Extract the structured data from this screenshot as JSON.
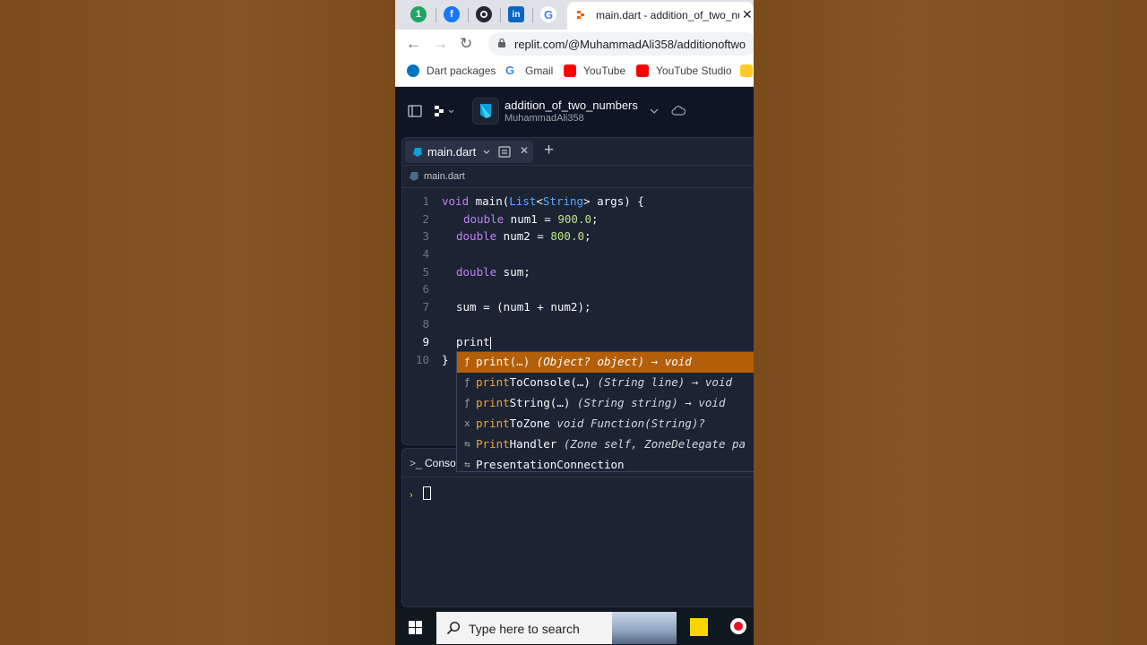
{
  "browser": {
    "tab_title": "main.dart - addition_of_two_num",
    "url": "replit.com/@MuhammadAli358/additionoftwo",
    "bookmarks": [
      "Dart packages",
      "Gmail",
      "YouTube",
      "YouTube Studio"
    ]
  },
  "replit": {
    "project_name": "addition_of_two_numbers",
    "project_user": "MuhammadAli358",
    "file_tab": "main.dart",
    "breadcrumb": "main.dart",
    "line_numbers": [
      "1",
      "2",
      "3",
      "4",
      "5",
      "6",
      "7",
      "8",
      "9",
      "10"
    ],
    "code": {
      "l1": {
        "kw": "void",
        "a": " main(",
        "ty1": "List",
        "b": "<",
        "ty2": "String",
        "c": "> args) {"
      },
      "l2": {
        "kw": "double",
        "a": " num1 = ",
        "num": "900.0",
        "b": ";"
      },
      "l3": {
        "kw": "double",
        "a": " num2 = ",
        "num": "800.0",
        "b": ";"
      },
      "l5": {
        "kw": "double",
        "a": " sum;"
      },
      "l7": "sum = (num1 + num2);",
      "l9": "print",
      "l10": "}"
    },
    "autocomplete": [
      {
        "kind": "ƒ",
        "match": "print",
        "rest": "(…)",
        "detail": " (Object? object) → void",
        "selected": true
      },
      {
        "kind": "ƒ",
        "match": "print",
        "rest": "ToConsole(…)",
        "detail": " (String line) → void"
      },
      {
        "kind": "ƒ",
        "match": "print",
        "rest": "String(…)",
        "detail": " (String string) → void"
      },
      {
        "kind": "x",
        "match": "print",
        "rest": "ToZone",
        "detail": " void Function(String)?"
      },
      {
        "kind": "⇆",
        "match": "Print",
        "rest": "Handler",
        "detail": " (Zone self, ZoneDelegate pa"
      },
      {
        "kind": "⇆",
        "match": "",
        "rest": "PresentationConnection",
        "detail": ""
      }
    ],
    "console_tab": "Conso",
    "console_prompt": "›"
  },
  "taskbar": {
    "search_placeholder": "Type here to search"
  }
}
